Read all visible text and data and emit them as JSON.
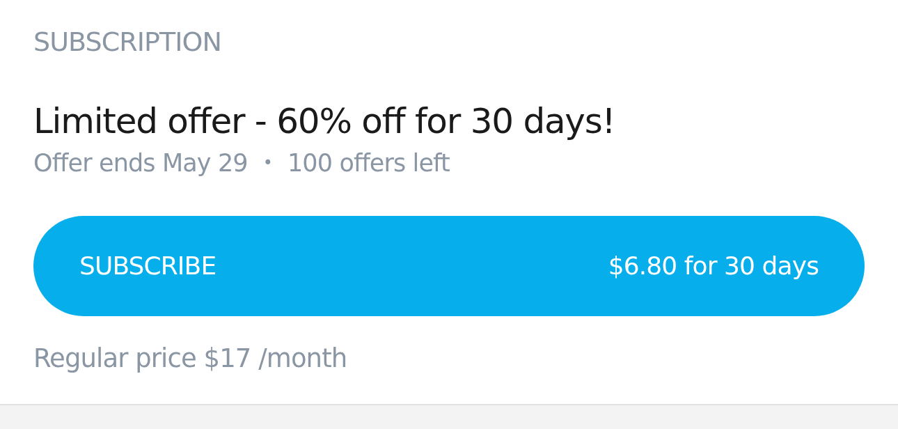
{
  "section_title": "SUBSCRIPTION",
  "offer": {
    "title": "Limited offer - 60% off for 30 days!",
    "ends": "Offer ends May 29",
    "separator": "•",
    "remaining": "100 offers left"
  },
  "subscribe_button": {
    "label": "SUBSCRIBE",
    "price": "$6.80 for 30 days"
  },
  "regular_price": "Regular price $17 /month"
}
